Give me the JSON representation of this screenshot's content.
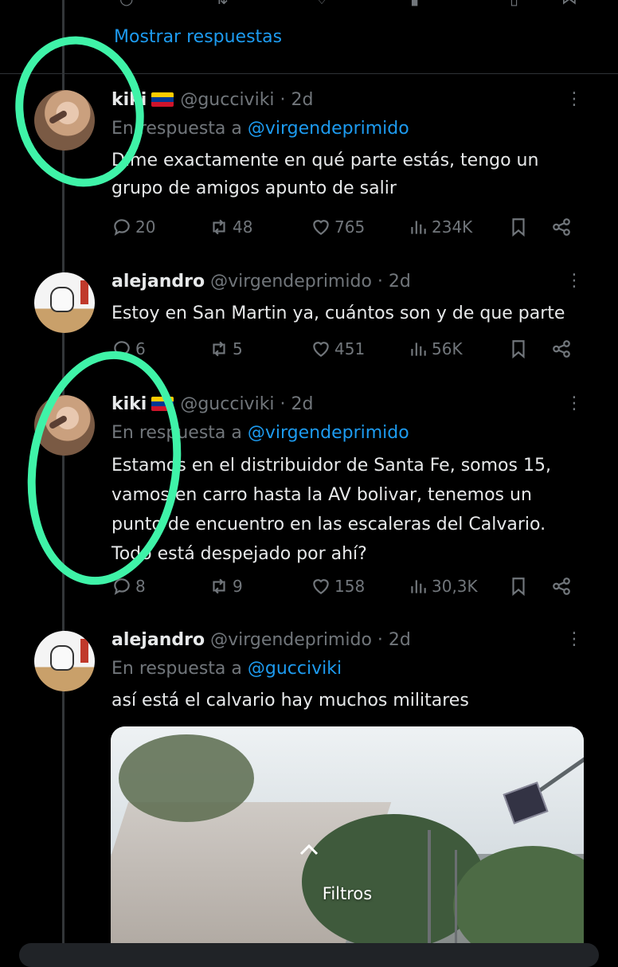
{
  "top_action_bar": {
    "icons": [
      "reply-icon",
      "retweet-icon",
      "like-icon",
      "views-icon",
      "bookmark-icon",
      "share-icon"
    ]
  },
  "show_replies": "Mostrar respuestas",
  "tweets": [
    {
      "name": "kiki",
      "flag": "venezuela-flag",
      "handle": "@gucciviki",
      "dot": "·",
      "time": "2d",
      "reply_prefix": "En respuesta a",
      "reply_mention": "@virgendeprimido",
      "text": "Dime exactamente en qué parte estás, tengo un grupo de amigos apunto de salir",
      "stats": {
        "replies": "20",
        "retweets": "48",
        "likes": "765",
        "views": "234K"
      }
    },
    {
      "name": "alejandro",
      "handle": "@virgendeprimido",
      "dot": "·",
      "time": "2d",
      "text": "Estoy en San Martin ya, cuántos son y de que parte",
      "stats": {
        "replies": "6",
        "retweets": "5",
        "likes": "451",
        "views": "56K"
      }
    },
    {
      "name": "kiki",
      "flag": "venezuela-flag",
      "handle": "@gucciviki",
      "dot": "·",
      "time": "2d",
      "reply_prefix": "En respuesta a",
      "reply_mention": "@virgendeprimido",
      "text": "Estamos en el distribuidor de Santa Fe, somos 15, vamos en carro hasta la AV bolivar, tenemos un punto de encuentro en las escaleras del Calvario. Todo está despejado por ahí?",
      "stats": {
        "replies": "8",
        "retweets": "9",
        "likes": "158",
        "views": "30,3K"
      }
    },
    {
      "name": "alejandro",
      "handle": "@virgendeprimido",
      "dot": "·",
      "time": "2d",
      "reply_prefix": "En respuesta a",
      "reply_mention": "@gucciviki",
      "text": "así está el calvario hay muchos militares"
    }
  ],
  "media_overlay": {
    "label": "Filtros"
  },
  "colors": {
    "accent": "#1d9bf0",
    "muted": "#71767b",
    "annotation": "#3ff3a8"
  }
}
